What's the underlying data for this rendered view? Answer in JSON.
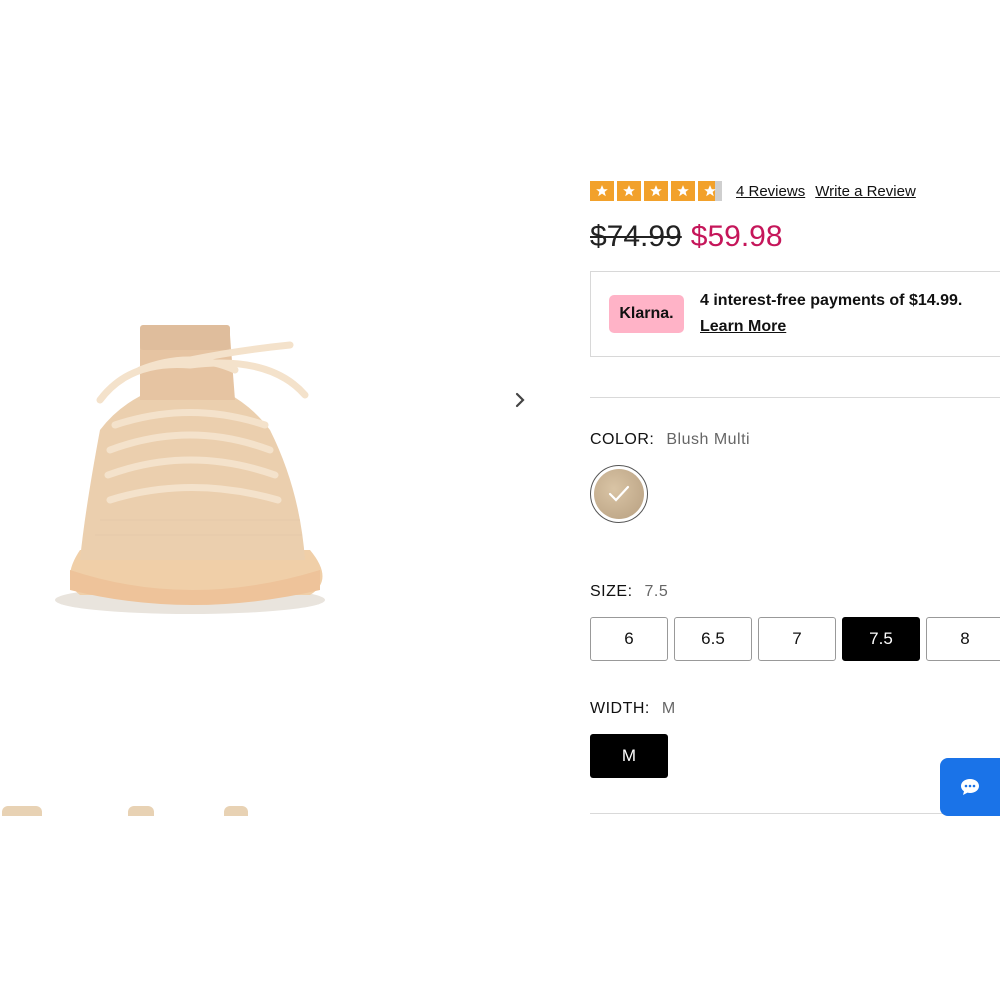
{
  "product": {
    "rating": {
      "stars": 4.7,
      "reviews_link": "4 Reviews",
      "write_review_link": "Write a Review"
    },
    "price": {
      "original": "$74.99",
      "sale": "$59.98",
      "sale_color": "#c5165a"
    },
    "klarna": {
      "badge": "Klarna.",
      "text": "4 interest-free payments of $14.99.",
      "learn_more": "Learn More",
      "badge_color": "#ffb3c7"
    },
    "color": {
      "label": "COLOR:",
      "value": "Blush Multi"
    },
    "size": {
      "label": "SIZE:",
      "value": "7.5",
      "options": [
        "6",
        "6.5",
        "7",
        "7.5",
        "8"
      ],
      "selected": "7.5"
    },
    "width": {
      "label": "WIDTH:",
      "value": "M",
      "options": [
        "M"
      ]
    }
  },
  "gallery": {
    "next_icon": "chevron-right-icon"
  },
  "chat": {
    "icon": "chat-bubble-icon",
    "color": "#1a73e8"
  }
}
